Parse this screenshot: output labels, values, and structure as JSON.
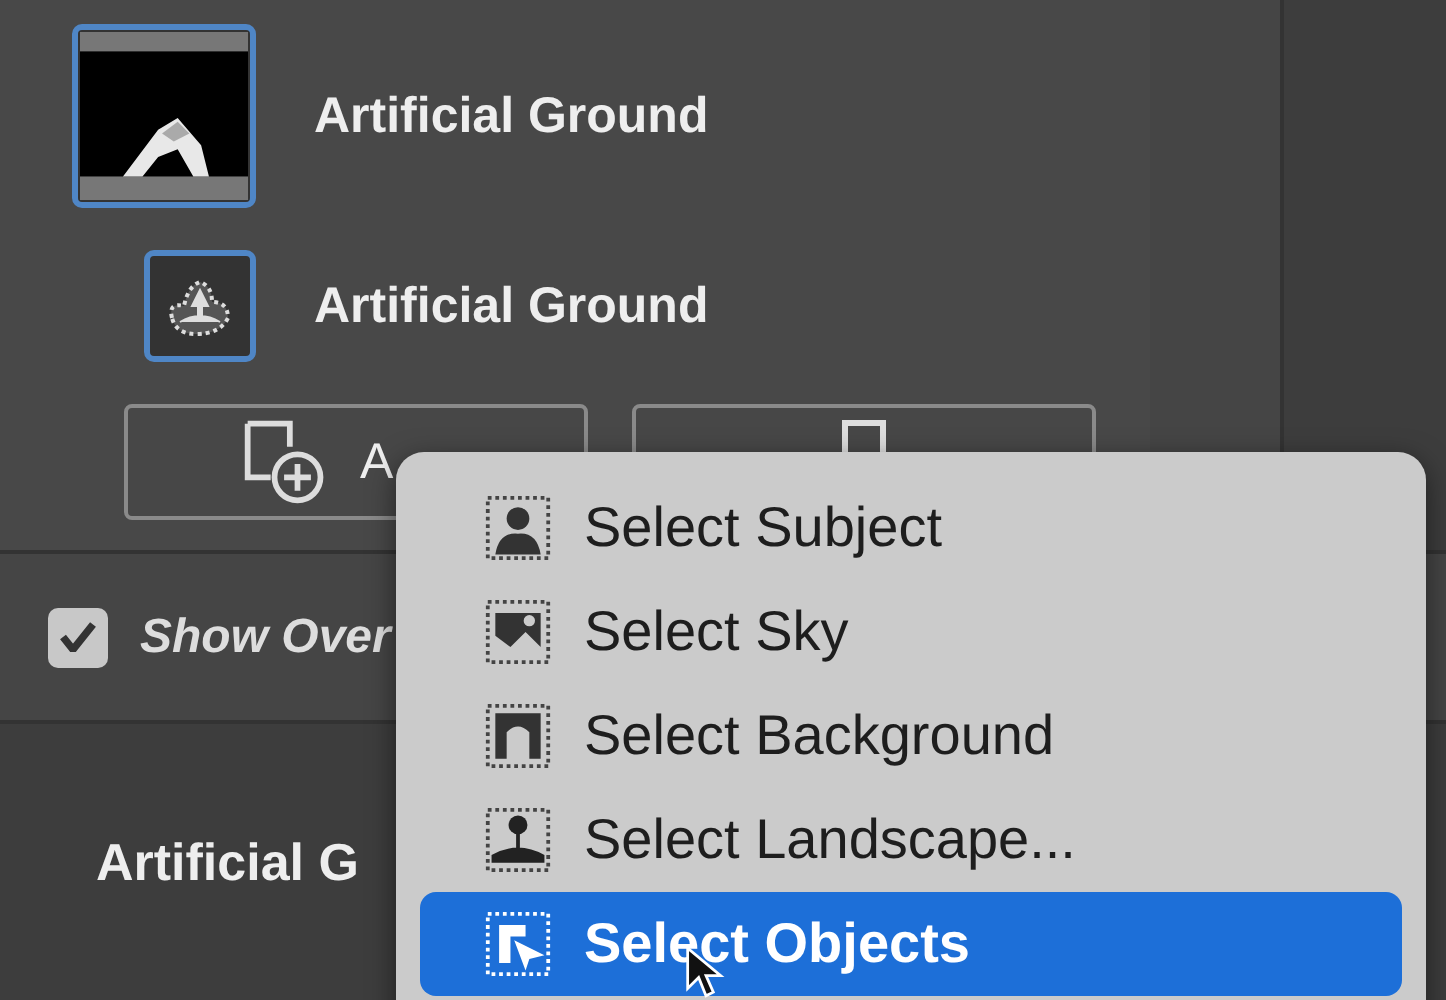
{
  "layers": [
    {
      "name": "Artificial Ground",
      "kind": "mask",
      "selected": true
    },
    {
      "name": "Artificial Ground",
      "kind": "selection",
      "selected": true
    }
  ],
  "buttons": [
    {
      "label": "A",
      "kind": "add"
    },
    {
      "kind": "subtract"
    }
  ],
  "show_overlay": {
    "label": "Show Over",
    "checked": true
  },
  "output_name": "Artificial G",
  "menu": {
    "items": [
      {
        "label": "Select Subject",
        "kind": "subject",
        "selected": false
      },
      {
        "label": "Select Sky",
        "kind": "sky",
        "selected": false
      },
      {
        "label": "Select Background",
        "kind": "background",
        "selected": false
      },
      {
        "label": "Select Landscape...",
        "kind": "landscape",
        "selected": false
      },
      {
        "label": "Select Objects",
        "kind": "objects",
        "selected": true
      }
    ]
  }
}
